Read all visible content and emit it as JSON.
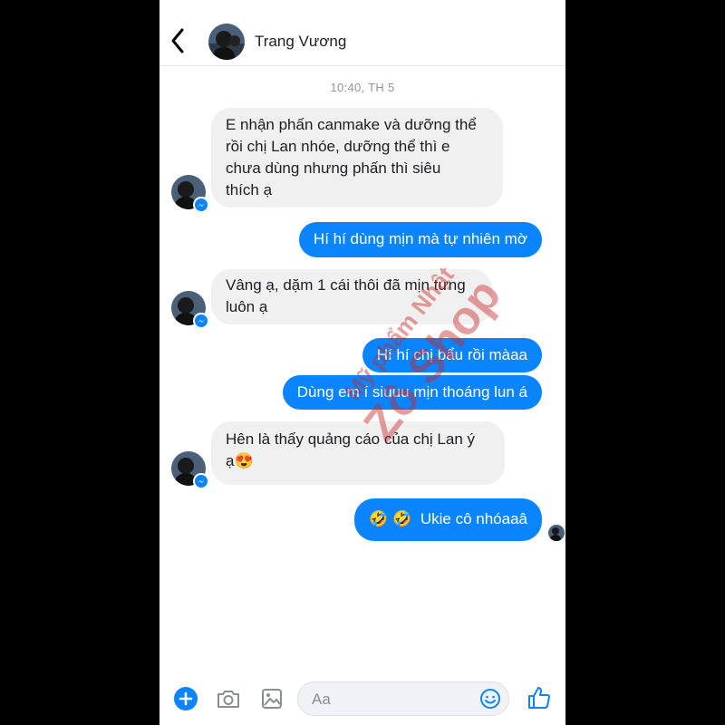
{
  "header": {
    "contact_name": "Trang Vương"
  },
  "timestamp": "10:40, TH 5",
  "messages": [
    {
      "from": "them",
      "lines": [
        "E nhận phấn canmake và dưỡng thể",
        "rồi chị Lan nhóe, dưỡng thể thì e",
        "chưa dùng nhưng phấn thì siêu",
        "thích ạ"
      ]
    },
    {
      "from": "me",
      "text": "Hí hí dùng mịn mà tự nhiên mờ"
    },
    {
      "from": "them",
      "lines": [
        "Vâng ạ, dặm 1 cái thôi đã mịn tưng",
        "luôn ạ"
      ]
    },
    {
      "from": "me",
      "text": "Hí hí chị bẩu rồi màaa"
    },
    {
      "from": "me",
      "text": "Dùng em í siuuu mịn thoáng lun á"
    },
    {
      "from": "them",
      "lines": [
        "Hên là thấy quảng cáo của chị Lan ý",
        "ạ"
      ],
      "emoji": "😍"
    },
    {
      "from": "me",
      "text": "Ukie cô nhóaaâ",
      "emojis": "🤣 🤣"
    }
  ],
  "composer": {
    "placeholder": "Aa"
  },
  "watermark": {
    "line1": "Mỹ phẩm Nhật",
    "line2": "Zô Shop"
  },
  "colors": {
    "accent": "#0a84ff",
    "incoming_bubble": "#f0f0f0"
  },
  "icons": [
    "back-chevron-icon",
    "add-icon",
    "camera-icon",
    "image-icon",
    "emoji-icon",
    "like-icon",
    "messenger-badge-icon"
  ]
}
